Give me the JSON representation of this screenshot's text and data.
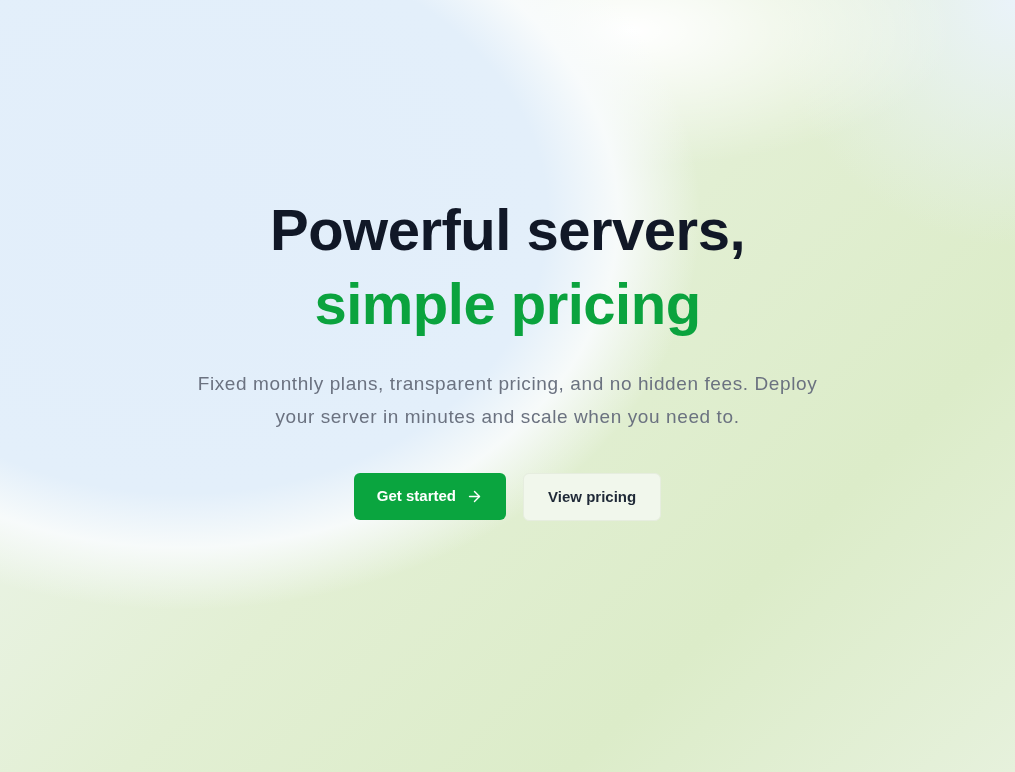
{
  "headline": {
    "line_1": "Powerful servers,",
    "line_2": "simple pricing"
  },
  "subtitle": "Fixed monthly plans, transparent pricing, and no hidden fees. Deploy your server in minutes and scale when you need to.",
  "buttons": [
    {
      "label": "Get started",
      "kind": "primary"
    },
    {
      "label": "View pricing",
      "kind": "secondary"
    }
  ]
}
